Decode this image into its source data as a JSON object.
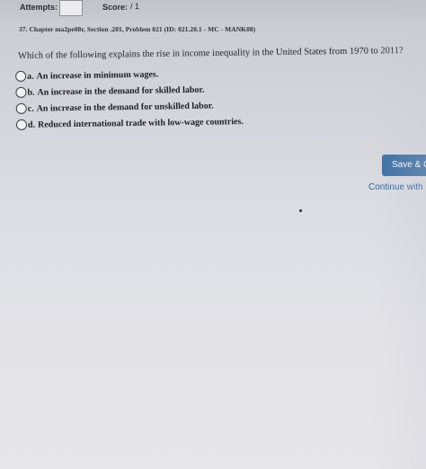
{
  "header": {
    "attempts_label": "Attempts:",
    "score_label": "Score:",
    "score_value": "/ 1"
  },
  "problem": {
    "id_line": "37. Chapter ma2pe08r, Section .201, Problem 021 (ID: 021.20.1 - MC - MANK08)",
    "question": "Which of the following explains the rise in income inequality in the United States from 1970 to 2011?",
    "options": [
      {
        "letter": "a.",
        "text": "An increase in minimum wages."
      },
      {
        "letter": "b.",
        "text": "An increase in the demand for skilled labor."
      },
      {
        "letter": "c.",
        "text": "An increase in the demand for unskilled labor."
      },
      {
        "letter": "d.",
        "text": "Reduced international trade with low-wage countries."
      }
    ]
  },
  "actions": {
    "save_label": "Save & C",
    "continue_label": "Continue with"
  },
  "colors": {
    "button": "#3d6fa3",
    "link": "#2c5f93"
  }
}
